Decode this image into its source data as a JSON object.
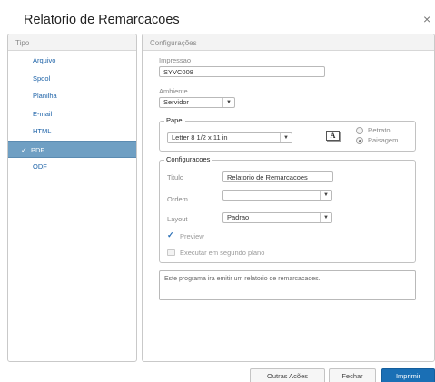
{
  "dialog": {
    "title": "Relatorio de Remarcacoes",
    "close_glyph": "×"
  },
  "left": {
    "header": "Tipo",
    "items": [
      {
        "label": "Arquivo",
        "active": false
      },
      {
        "label": "Spool",
        "active": false
      },
      {
        "label": "Planilha",
        "active": false
      },
      {
        "label": "E-mail",
        "active": false
      },
      {
        "label": "HTML",
        "active": false
      },
      {
        "label": "PDF",
        "active": true
      },
      {
        "label": "ODF",
        "active": false
      }
    ],
    "check_glyph": "✓"
  },
  "right": {
    "header": "Configurações",
    "impressao": {
      "label": "Impressao",
      "value": "SYVC008"
    },
    "ambiente": {
      "label": "Ambiente",
      "value": "Servidor"
    },
    "papel": {
      "legend": "Papel",
      "size_value": "Letter 8 1/2 x 11 in",
      "icon_glyph": "A",
      "retrato_label": "Retrato",
      "paisagem_label": "Paisagem",
      "orientation_selected": "Paisagem"
    },
    "configuracoes": {
      "legend": "Configuracoes",
      "titulo_label": "Titulo",
      "titulo_value": "Relatorio de Remarcacoes",
      "ordem_label": "Ordem",
      "ordem_value": "",
      "layout_label": "Layout",
      "layout_value": "Padrao",
      "preview_label": "Preview",
      "preview_checked": true,
      "executar_label": "Executar em segundo plano",
      "executar_checked": false
    },
    "description": "Este programa ira emitir um relatorio de remarcacaoes."
  },
  "footer": {
    "outras_label": "Outras Acões",
    "fechar_label": "Fechar",
    "imprimir_label": "Imprimir"
  },
  "colors": {
    "accent": "#1a6fb5",
    "selected_item_bg": "#6f9fc3",
    "link_text": "#1e63a8"
  },
  "icons": {
    "close": "close-icon",
    "check": "check-icon",
    "dropdown": "chevron-down-icon",
    "font_preview": "font-preview-icon"
  }
}
